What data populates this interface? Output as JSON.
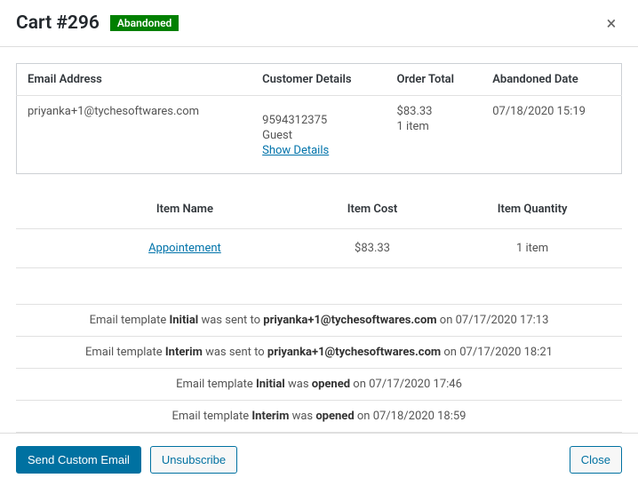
{
  "header": {
    "title": "Cart #296",
    "badge": "Abandoned"
  },
  "detail": {
    "headers": {
      "email": "Email Address",
      "customer": "Customer Details",
      "total": "Order Total",
      "date": "Abandoned Date"
    },
    "email": "priyanka+1@tychesoftwares.com",
    "customer_phone": "9594312375",
    "customer_type": "Guest",
    "customer_link": "Show Details",
    "total_amount": "$83.33",
    "total_items": "1 item",
    "abandoned_date": "07/18/2020 15:19"
  },
  "items": {
    "headers": {
      "name": "Item Name",
      "cost": "Item Cost",
      "qty": "Item Quantity"
    },
    "rows": [
      {
        "name": "Appointement",
        "cost": "$83.33",
        "qty": "1 item"
      }
    ]
  },
  "log": [
    {
      "prefix": "Email template ",
      "bold1": "Initial",
      "mid": " was sent to ",
      "bold2": "priyanka+1@tychesoftwares.com",
      "suffix": " on 07/17/2020 17:13"
    },
    {
      "prefix": "Email template ",
      "bold1": "Interim",
      "mid": " was sent to ",
      "bold2": "priyanka+1@tychesoftwares.com",
      "suffix": " on 07/17/2020 18:21"
    },
    {
      "prefix": "Email template ",
      "bold1": "Initial",
      "mid": " was ",
      "bold2": "opened",
      "suffix": " on 07/17/2020 17:46"
    },
    {
      "prefix": "Email template ",
      "bold1": "Interim",
      "mid": " was ",
      "bold2": "opened",
      "suffix": " on 07/18/2020 18:59"
    }
  ],
  "footer": {
    "send": "Send Custom Email",
    "unsubscribe": "Unsubscribe",
    "close": "Close"
  }
}
